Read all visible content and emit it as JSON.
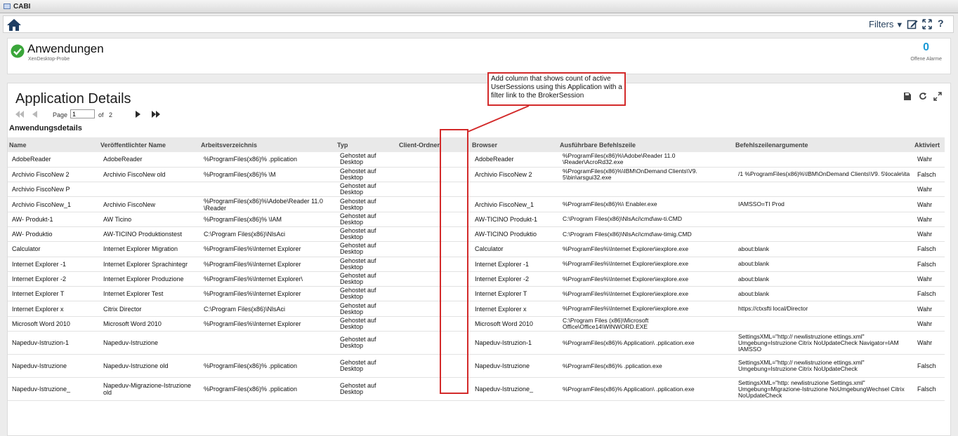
{
  "window": {
    "title": "CABI"
  },
  "toolbar": {
    "filters_label": "Filters",
    "help_label": "?"
  },
  "summary": {
    "title": "Anwendungen",
    "subtitle": "XenDesktop-Probe",
    "alarm_count": "0",
    "alarm_label": "Offene Alarme"
  },
  "panel": {
    "title": "Application Details",
    "section_label": "Anwendungsdetails",
    "pager": {
      "page_label": "Page",
      "page_value": "1",
      "of_label": "of",
      "total_pages": "2"
    }
  },
  "table": {
    "columns": [
      "Name",
      "Veröffentlichter Name",
      "Arbeitsverzeichnis",
      "Typ",
      "Client-Ordner",
      "Browser",
      "Ausführbare Befehlszeile",
      "Befehlszeilenargumente",
      "Aktiviert"
    ],
    "rows": [
      {
        "name": "AdobeReader",
        "published": "AdobeReader",
        "workdir": "%ProgramFiles(x86)%            .pplication",
        "type": "Gehostet auf Desktop",
        "client_folder": "",
        "browser": "AdobeReader",
        "cmdline": "%ProgramFiles(x86)%\\Adobe\\Reader 11.0 \\Reader\\AcroRd32.exe",
        "args": "",
        "enabled": "Wahr"
      },
      {
        "name": "Archivio FiscoNew 2",
        "published": "Archivio FiscoNew old",
        "workdir": "%ProgramFiles(x86)%            \\M",
        "type": "Gehostet auf Desktop",
        "client_folder": "",
        "browser": "Archivio FiscoNew 2",
        "cmdline": "%ProgramFiles(x86)%\\IBM\\OnDemand Clients\\V9. 5\\bin\\arsgui32.exe",
        "args": "/1 %ProgramFiles(x86)%\\IBM\\OnDemand Clients\\V9. 5\\locale\\ita",
        "enabled": "Falsch"
      },
      {
        "name": "Archivio FiscoNew P",
        "published": "",
        "workdir": "",
        "type": "Gehostet auf Desktop",
        "client_folder": "",
        "browser": "",
        "cmdline": "",
        "args": "",
        "enabled": "Wahr"
      },
      {
        "name": "Archivio FiscoNew_1",
        "published": "Archivio FiscoNew",
        "workdir": "%ProgramFiles(x86)%\\Adobe\\Reader 11.0 \\Reader",
        "type": "Gehostet auf Desktop",
        "client_folder": "",
        "browser": "Archivio FiscoNew_1",
        "cmdline": "%ProgramFiles(x86)%\\                              Enabler.exe",
        "args": "IAMSSO=TI Prod",
        "enabled": "Wahr"
      },
      {
        "name": "AW-           Produkt-1",
        "published": "AW Ticino",
        "workdir": "%ProgramFiles(x86)%            \\IAM",
        "type": "Gehostet auf Desktop",
        "client_folder": "",
        "browser": "AW-TICINO Produkt-1",
        "cmdline": "C:\\Program Files(x86)\\NlsAci\\cmd\\aw-ti.CMD",
        "args": "",
        "enabled": "Wahr"
      },
      {
        "name": "AW-           Produktio",
        "published": "AW-TICINO Produktionstest",
        "workdir": "C:\\Program Files(x86)\\NlsAci",
        "type": "Gehostet auf Desktop",
        "client_folder": "",
        "browser": "AW-TICINO Produktio",
        "cmdline": "C:\\Program Files(x86)\\NlsAci\\cmd\\aw-timig.CMD",
        "args": "",
        "enabled": "Wahr"
      },
      {
        "name": "Calculator",
        "published": "Internet Explorer Migration",
        "workdir": "%ProgramFiles%\\Internet Explorer",
        "type": "Gehostet auf Desktop",
        "client_folder": "",
        "browser": "Calculator",
        "cmdline": "%ProgramFiles%\\Internet Explorer\\iexplore.exe",
        "args": "about:blank",
        "enabled": "Falsch"
      },
      {
        "name": "Internet Explorer -1",
        "published": "Internet Explorer Sprachintegr",
        "workdir": "%ProgramFiles%\\Internet Explorer",
        "type": "Gehostet auf Desktop",
        "client_folder": "",
        "browser": "Internet Explorer -1",
        "cmdline": "%ProgramFiles%\\Internet Explorer\\iexplore.exe",
        "args": "about:blank",
        "enabled": "Falsch"
      },
      {
        "name": "Internet Explorer -2",
        "published": "Internet Explorer Produzione",
        "workdir": "%ProgramFiles%\\Internet Explorer\\",
        "type": "Gehostet auf Desktop",
        "client_folder": "",
        "browser": "Internet Explorer -2",
        "cmdline": "%ProgramFiles%\\Internet Explorer\\iexplore.exe",
        "args": "about:blank",
        "enabled": "Wahr"
      },
      {
        "name": "Internet Explorer T",
        "published": "Internet Explorer Test",
        "workdir": "%ProgramFiles%\\Internet Explorer",
        "type": "Gehostet auf Desktop",
        "client_folder": "",
        "browser": "Internet Explorer T",
        "cmdline": "%ProgramFiles%\\Internet Explorer\\iexplore.exe",
        "args": "about:blank",
        "enabled": "Falsch"
      },
      {
        "name": "Internet Explorer x",
        "published": "Citrix Director",
        "workdir": "C:\\Program Files(x86)\\NlsAci",
        "type": "Gehostet auf Desktop",
        "client_folder": "",
        "browser": "Internet Explorer x",
        "cmdline": "%ProgramFiles%\\Internet Explorer\\iexplore.exe",
        "args": "https://ctxsfti           local/Director",
        "enabled": "Wahr"
      },
      {
        "name": "Microsoft Word 2010",
        "published": "Microsoft Word 2010",
        "workdir": "%ProgramFiles%\\Internet Explorer",
        "type": "Gehostet auf Desktop",
        "client_folder": "",
        "browser": "Microsoft Word 2010",
        "cmdline": "C:\\Program Files (x86)\\Microsoft Office\\Office14\\WINWORD.EXE",
        "args": "",
        "enabled": "Wahr"
      },
      {
        "name": "Napeduv-Istruzion-1",
        "published": "Napeduv-Istruzione",
        "workdir": "",
        "type": "Gehostet auf Desktop",
        "client_folder": "",
        "browser": "Napeduv-Istruzion-1",
        "cmdline": "%ProgramFiles(x86)%               Application\\              .pplication.exe",
        "args": "SettingsXML=\"http://         newlistruzione          ettings.xml\" Umgebung=Istruzione Citrix NoUpdateCheck Navigator=IAM IAMSSO",
        "enabled": "Wahr"
      },
      {
        "name": "Napeduv-Istruzione",
        "published": "Napeduv-Istruzione old",
        "workdir": "%ProgramFiles(x86)%            .pplication",
        "type": "Gehostet auf Desktop",
        "client_folder": "",
        "browser": "Napeduv-Istruzione",
        "cmdline": "%ProgramFiles(x86)%                                .pplication.exe",
        "args": "SettingsXML=\"http://         newlistruzione          ettings.xml\" Umgebung=Istruzione Citrix NoUpdateCheck",
        "enabled": "Falsch"
      },
      {
        "name": "Napeduv-Istruzione_",
        "published": "Napeduv-Migrazione-Istruzione old",
        "workdir": "%ProgramFiles(x86)%            .pplication",
        "type": "Gehostet auf Desktop",
        "client_folder": "",
        "browser": "Napeduv-Istruzione_",
        "cmdline": "%ProgramFiles(x86)%  Application\\              .pplication.exe",
        "args": "SettingsXML=\"http:         newlistruzione     Settings.xml\" Umgebung=Migrazione-Istruzione NoUmgebungWechsel Citrix NoUpdateCheck",
        "enabled": "Falsch"
      }
    ]
  },
  "annotation": {
    "text": "Add column that shows count of active UserSessions using this Application with a filter link to the BrokerSession",
    "color": "#d32a2a"
  },
  "colors": {
    "accent": "#1a9ad6",
    "ok_green": "#3aa63a",
    "header_bg": "#e9e9e9",
    "annotation_red": "#d32a2a"
  },
  "icons": [
    "home-icon",
    "filter-caret-icon",
    "edit-icon",
    "fullscreen-icon",
    "help-icon",
    "status-ok-icon",
    "export-icon",
    "refresh-icon",
    "expand-icon",
    "first-page-icon",
    "prev-page-icon",
    "next-page-icon",
    "last-page-icon"
  ]
}
